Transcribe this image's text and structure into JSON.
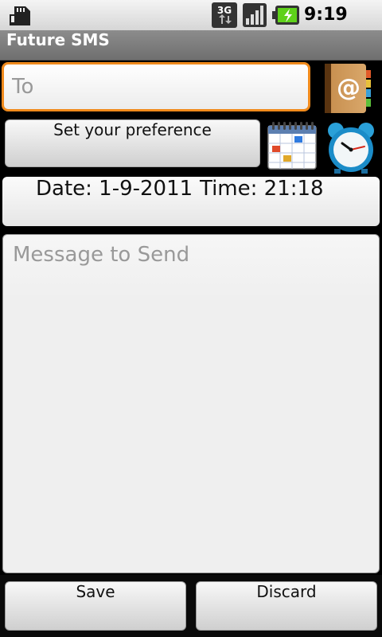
{
  "status_bar": {
    "time": "9:19 PM",
    "network": "3G",
    "icons": [
      "sd-card-icon",
      "network-3g-icon",
      "signal-icon",
      "battery-charging-icon"
    ]
  },
  "app": {
    "title": "Future SMS"
  },
  "to_field": {
    "placeholder": "To",
    "value": ""
  },
  "preference_button": {
    "label": "Set your preference"
  },
  "schedule": {
    "date_label": "Date: 1-9-2011",
    "time_label": "Time: 21:18"
  },
  "message": {
    "placeholder": "Message to Send",
    "value": ""
  },
  "actions": {
    "save_label": "Save",
    "discard_label": "Discard"
  },
  "colors": {
    "focus_border": "#f08a1c",
    "title_bar": "#7a7a7a"
  }
}
